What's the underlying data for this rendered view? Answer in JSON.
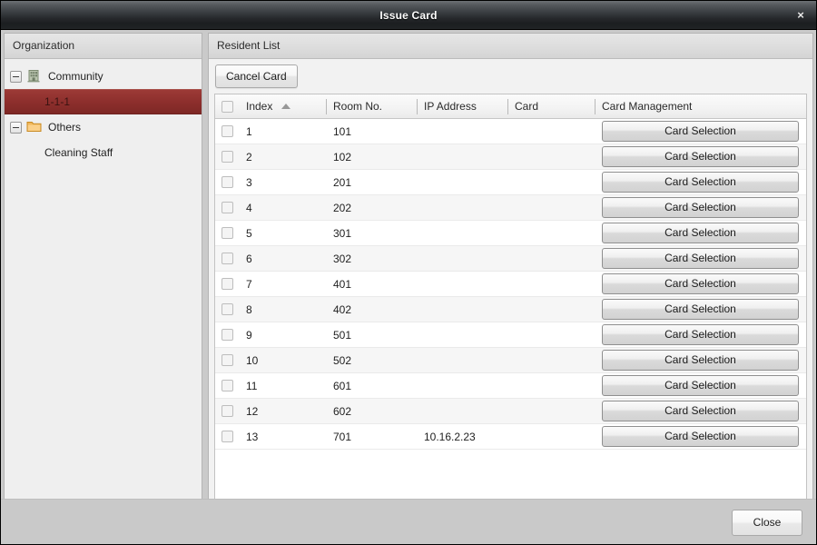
{
  "window": {
    "title": "Issue Card",
    "close_icon": "close-icon",
    "close_glyph": "×"
  },
  "organization": {
    "header": "Organization",
    "items": [
      {
        "label": "Community",
        "level": 0,
        "icon": "building-icon",
        "expander": "collapse-toggle",
        "selected": false
      },
      {
        "label": "1-1-1",
        "level": 1,
        "icon": "",
        "expander": "",
        "selected": true
      },
      {
        "label": "Others",
        "level": 0,
        "icon": "folder-icon",
        "expander": "collapse-toggle",
        "selected": false
      },
      {
        "label": "Cleaning Staff",
        "level": 1,
        "icon": "",
        "expander": "",
        "selected": false
      }
    ]
  },
  "resident": {
    "header": "Resident List",
    "toolbar": {
      "cancel_card_label": "Cancel Card"
    },
    "table": {
      "select_all_checkbox": "select-all-checkbox",
      "sort_column": "Index",
      "sort_direction": "ascending",
      "columns": [
        {
          "key": "index",
          "label": "Index"
        },
        {
          "key": "room",
          "label": "Room No."
        },
        {
          "key": "ip",
          "label": "IP Address"
        },
        {
          "key": "card",
          "label": "Card"
        },
        {
          "key": "mgmt",
          "label": "Card Management"
        }
      ],
      "row_action_label": "Card Selection",
      "rows": [
        {
          "index": "1",
          "room": "101",
          "ip": "",
          "card": "",
          "checked": false
        },
        {
          "index": "2",
          "room": "102",
          "ip": "",
          "card": "",
          "checked": false
        },
        {
          "index": "3",
          "room": "201",
          "ip": "",
          "card": "",
          "checked": false
        },
        {
          "index": "4",
          "room": "202",
          "ip": "",
          "card": "",
          "checked": false
        },
        {
          "index": "5",
          "room": "301",
          "ip": "",
          "card": "",
          "checked": false
        },
        {
          "index": "6",
          "room": "302",
          "ip": "",
          "card": "",
          "checked": false
        },
        {
          "index": "7",
          "room": "401",
          "ip": "",
          "card": "",
          "checked": false
        },
        {
          "index": "8",
          "room": "402",
          "ip": "",
          "card": "",
          "checked": false
        },
        {
          "index": "9",
          "room": "501",
          "ip": "",
          "card": "",
          "checked": false
        },
        {
          "index": "10",
          "room": "502",
          "ip": "",
          "card": "",
          "checked": false
        },
        {
          "index": "11",
          "room": "601",
          "ip": "",
          "card": "",
          "checked": false
        },
        {
          "index": "12",
          "room": "602",
          "ip": "",
          "card": "",
          "checked": false
        },
        {
          "index": "13",
          "room": "701",
          "ip": "10.16.2.23",
          "card": "",
          "checked": false
        }
      ]
    }
  },
  "footer": {
    "close_label": "Close"
  },
  "colors": {
    "selection_red": "#8c2e2c",
    "titlebar_dark": "#26292c",
    "panel_bg": "#efefef",
    "footer_bg": "#c9c9c9",
    "folder_orange": "#e8a33d",
    "building_green": "#93a383"
  }
}
